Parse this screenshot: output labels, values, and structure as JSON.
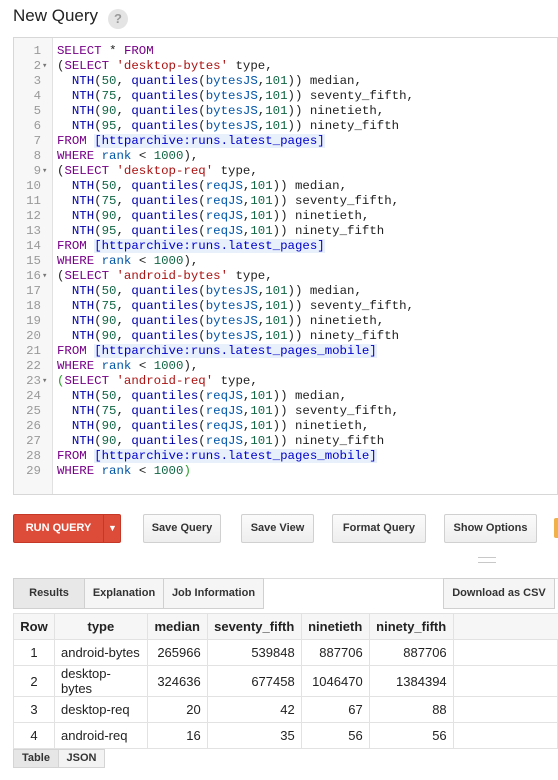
{
  "header": {
    "title": "New Query",
    "help_label": "?"
  },
  "editor": {
    "lines": [
      {
        "n": "1",
        "fold": "",
        "t": [
          [
            "kw",
            "SELECT"
          ],
          [
            "",
            "*"
          ],
          [
            "kw",
            "FROM"
          ]
        ]
      },
      {
        "n": "2",
        "fold": "▾",
        "t": [
          [
            "",
            "("
          ],
          [
            "kw",
            "SELECT"
          ],
          [
            "str",
            "'desktop-bytes'"
          ],
          [
            "",
            "type,"
          ]
        ]
      },
      {
        "n": "3",
        "fold": "",
        "t": [
          [
            "",
            "  "
          ],
          [
            "fn",
            "NTH"
          ],
          [
            "",
            "("
          ],
          [
            "num",
            "50"
          ],
          [
            "",
            ", "
          ],
          [
            "fn",
            "quantiles"
          ],
          [
            "",
            "("
          ],
          [
            "var",
            "bytesJS"
          ],
          [
            "",
            ","
          ],
          [
            "num",
            "101"
          ],
          [
            "",
            "))"
          ],
          [
            "",
            " median,"
          ]
        ]
      },
      {
        "n": "4",
        "fold": "",
        "t": [
          [
            "",
            "  "
          ],
          [
            "fn",
            "NTH"
          ],
          [
            "",
            "("
          ],
          [
            "num",
            "75"
          ],
          [
            "",
            ", "
          ],
          [
            "fn",
            "quantiles"
          ],
          [
            "",
            "("
          ],
          [
            "var",
            "bytesJS"
          ],
          [
            "",
            ","
          ],
          [
            "num",
            "101"
          ],
          [
            "",
            "))"
          ],
          [
            "",
            " seventy_fifth,"
          ]
        ]
      },
      {
        "n": "5",
        "fold": "",
        "t": [
          [
            "",
            "  "
          ],
          [
            "fn",
            "NTH"
          ],
          [
            "",
            "("
          ],
          [
            "num",
            "90"
          ],
          [
            "",
            ", "
          ],
          [
            "fn",
            "quantiles"
          ],
          [
            "",
            "("
          ],
          [
            "var",
            "bytesJS"
          ],
          [
            "",
            ","
          ],
          [
            "num",
            "101"
          ],
          [
            "",
            "))"
          ],
          [
            "",
            " ninetieth,"
          ]
        ]
      },
      {
        "n": "6",
        "fold": "",
        "t": [
          [
            "",
            "  "
          ],
          [
            "fn",
            "NTH"
          ],
          [
            "",
            "("
          ],
          [
            "num",
            "95"
          ],
          [
            "",
            ", "
          ],
          [
            "fn",
            "quantiles"
          ],
          [
            "",
            "("
          ],
          [
            "var",
            "bytesJS"
          ],
          [
            "",
            ","
          ],
          [
            "num",
            "101"
          ],
          [
            "",
            "))"
          ],
          [
            "",
            " ninety_fifth"
          ]
        ]
      },
      {
        "n": "7",
        "fold": "",
        "t": [
          [
            "kw",
            "FROM"
          ],
          [
            "tbl",
            "[httparchive:runs.latest_pages]"
          ]
        ]
      },
      {
        "n": "8",
        "fold": "",
        "t": [
          [
            "kw",
            "WHERE"
          ],
          [
            "var",
            "rank"
          ],
          [
            "",
            "<"
          ],
          [
            "num",
            "1000"
          ],
          [
            "",
            "),"
          ]
        ]
      },
      {
        "n": "9",
        "fold": "▾",
        "t": [
          [
            "",
            "("
          ],
          [
            "kw",
            "SELECT"
          ],
          [
            "str",
            "'desktop-req'"
          ],
          [
            "",
            "type,"
          ]
        ]
      },
      {
        "n": "10",
        "fold": "",
        "t": [
          [
            "",
            "  "
          ],
          [
            "fn",
            "NTH"
          ],
          [
            "",
            "("
          ],
          [
            "num",
            "50"
          ],
          [
            "",
            ", "
          ],
          [
            "fn",
            "quantiles"
          ],
          [
            "",
            "("
          ],
          [
            "var",
            "reqJS"
          ],
          [
            "",
            ","
          ],
          [
            "num",
            "101"
          ],
          [
            "",
            "))"
          ],
          [
            "",
            " median,"
          ]
        ]
      },
      {
        "n": "11",
        "fold": "",
        "t": [
          [
            "",
            "  "
          ],
          [
            "fn",
            "NTH"
          ],
          [
            "",
            "("
          ],
          [
            "num",
            "75"
          ],
          [
            "",
            ", "
          ],
          [
            "fn",
            "quantiles"
          ],
          [
            "",
            "("
          ],
          [
            "var",
            "reqJS"
          ],
          [
            "",
            ","
          ],
          [
            "num",
            "101"
          ],
          [
            "",
            "))"
          ],
          [
            "",
            " seventy_fifth,"
          ]
        ]
      },
      {
        "n": "12",
        "fold": "",
        "t": [
          [
            "",
            "  "
          ],
          [
            "fn",
            "NTH"
          ],
          [
            "",
            "("
          ],
          [
            "num",
            "90"
          ],
          [
            "",
            ", "
          ],
          [
            "fn",
            "quantiles"
          ],
          [
            "",
            "("
          ],
          [
            "var",
            "reqJS"
          ],
          [
            "",
            ","
          ],
          [
            "num",
            "101"
          ],
          [
            "",
            "))"
          ],
          [
            "",
            " ninetieth,"
          ]
        ]
      },
      {
        "n": "13",
        "fold": "",
        "t": [
          [
            "",
            "  "
          ],
          [
            "fn",
            "NTH"
          ],
          [
            "",
            "("
          ],
          [
            "num",
            "95"
          ],
          [
            "",
            ", "
          ],
          [
            "fn",
            "quantiles"
          ],
          [
            "",
            "("
          ],
          [
            "var",
            "reqJS"
          ],
          [
            "",
            ","
          ],
          [
            "num",
            "101"
          ],
          [
            "",
            "))"
          ],
          [
            "",
            " ninety_fifth"
          ]
        ]
      },
      {
        "n": "14",
        "fold": "",
        "t": [
          [
            "kw",
            "FROM"
          ],
          [
            "tbl",
            "[httparchive:runs.latest_pages]"
          ]
        ]
      },
      {
        "n": "15",
        "fold": "",
        "t": [
          [
            "kw",
            "WHERE"
          ],
          [
            "var",
            "rank"
          ],
          [
            "",
            "<"
          ],
          [
            "num",
            "1000"
          ],
          [
            "",
            "),"
          ]
        ]
      },
      {
        "n": "16",
        "fold": "▾",
        "t": [
          [
            "",
            "("
          ],
          [
            "kw",
            "SELECT"
          ],
          [
            "str",
            "'android-bytes'"
          ],
          [
            "",
            "type,"
          ]
        ]
      },
      {
        "n": "17",
        "fold": "",
        "t": [
          [
            "",
            "  "
          ],
          [
            "fn",
            "NTH"
          ],
          [
            "",
            "("
          ],
          [
            "num",
            "50"
          ],
          [
            "",
            ", "
          ],
          [
            "fn",
            "quantiles"
          ],
          [
            "",
            "("
          ],
          [
            "var",
            "bytesJS"
          ],
          [
            "",
            ","
          ],
          [
            "num",
            "101"
          ],
          [
            "",
            "))"
          ],
          [
            "",
            " median,"
          ]
        ]
      },
      {
        "n": "18",
        "fold": "",
        "t": [
          [
            "",
            "  "
          ],
          [
            "fn",
            "NTH"
          ],
          [
            "",
            "("
          ],
          [
            "num",
            "75"
          ],
          [
            "",
            ", "
          ],
          [
            "fn",
            "quantiles"
          ],
          [
            "",
            "("
          ],
          [
            "var",
            "bytesJS"
          ],
          [
            "",
            ","
          ],
          [
            "num",
            "101"
          ],
          [
            "",
            "))"
          ],
          [
            "",
            " seventy_fifth,"
          ]
        ]
      },
      {
        "n": "19",
        "fold": "",
        "t": [
          [
            "",
            "  "
          ],
          [
            "fn",
            "NTH"
          ],
          [
            "",
            "("
          ],
          [
            "num",
            "90"
          ],
          [
            "",
            ", "
          ],
          [
            "fn",
            "quantiles"
          ],
          [
            "",
            "("
          ],
          [
            "var",
            "bytesJS"
          ],
          [
            "",
            ","
          ],
          [
            "num",
            "101"
          ],
          [
            "",
            "))"
          ],
          [
            "",
            " ninetieth,"
          ]
        ]
      },
      {
        "n": "20",
        "fold": "",
        "t": [
          [
            "",
            "  "
          ],
          [
            "fn",
            "NTH"
          ],
          [
            "",
            "("
          ],
          [
            "num",
            "90"
          ],
          [
            "",
            ", "
          ],
          [
            "fn",
            "quantiles"
          ],
          [
            "",
            "("
          ],
          [
            "var",
            "bytesJS"
          ],
          [
            "",
            ","
          ],
          [
            "num",
            "101"
          ],
          [
            "",
            "))"
          ],
          [
            "",
            " ninety_fifth"
          ]
        ]
      },
      {
        "n": "21",
        "fold": "",
        "t": [
          [
            "kw",
            "FROM"
          ],
          [
            "tbl",
            "[httparchive:runs.latest_pages_mobile]"
          ]
        ]
      },
      {
        "n": "22",
        "fold": "",
        "t": [
          [
            "kw",
            "WHERE"
          ],
          [
            "var",
            "rank"
          ],
          [
            "",
            "<"
          ],
          [
            "num",
            "1000"
          ],
          [
            "",
            "),"
          ]
        ]
      },
      {
        "n": "23",
        "fold": "▾",
        "t": [
          [
            "br",
            "("
          ],
          [
            "kw",
            "SELECT"
          ],
          [
            "str",
            "'android-req'"
          ],
          [
            "",
            "type,"
          ]
        ]
      },
      {
        "n": "24",
        "fold": "",
        "t": [
          [
            "",
            "  "
          ],
          [
            "fn",
            "NTH"
          ],
          [
            "",
            "("
          ],
          [
            "num",
            "50"
          ],
          [
            "",
            ", "
          ],
          [
            "fn",
            "quantiles"
          ],
          [
            "",
            "("
          ],
          [
            "var",
            "reqJS"
          ],
          [
            "",
            ","
          ],
          [
            "num",
            "101"
          ],
          [
            "",
            "))"
          ],
          [
            "",
            " median,"
          ]
        ]
      },
      {
        "n": "25",
        "fold": "",
        "t": [
          [
            "",
            "  "
          ],
          [
            "fn",
            "NTH"
          ],
          [
            "",
            "("
          ],
          [
            "num",
            "75"
          ],
          [
            "",
            ", "
          ],
          [
            "fn",
            "quantiles"
          ],
          [
            "",
            "("
          ],
          [
            "var",
            "reqJS"
          ],
          [
            "",
            ","
          ],
          [
            "num",
            "101"
          ],
          [
            "",
            "))"
          ],
          [
            "",
            " seventy_fifth,"
          ]
        ]
      },
      {
        "n": "26",
        "fold": "",
        "t": [
          [
            "",
            "  "
          ],
          [
            "fn",
            "NTH"
          ],
          [
            "",
            "("
          ],
          [
            "num",
            "90"
          ],
          [
            "",
            ", "
          ],
          [
            "fn",
            "quantiles"
          ],
          [
            "",
            "("
          ],
          [
            "var",
            "reqJS"
          ],
          [
            "",
            ","
          ],
          [
            "num",
            "101"
          ],
          [
            "",
            "))"
          ],
          [
            "",
            " ninetieth,"
          ]
        ]
      },
      {
        "n": "27",
        "fold": "",
        "t": [
          [
            "",
            "  "
          ],
          [
            "fn",
            "NTH"
          ],
          [
            "",
            "("
          ],
          [
            "num",
            "90"
          ],
          [
            "",
            ", "
          ],
          [
            "fn",
            "quantiles"
          ],
          [
            "",
            "("
          ],
          [
            "var",
            "reqJS"
          ],
          [
            "",
            ","
          ],
          [
            "num",
            "101"
          ],
          [
            "",
            "))"
          ],
          [
            "",
            " ninety_fifth"
          ]
        ]
      },
      {
        "n": "28",
        "fold": "",
        "t": [
          [
            "kw",
            "FROM"
          ],
          [
            "tbl",
            "[httparchive:runs.latest_pages_mobile]"
          ]
        ]
      },
      {
        "n": "29",
        "fold": "",
        "t": [
          [
            "kw",
            "WHERE"
          ],
          [
            "var",
            "rank"
          ],
          [
            "",
            "<"
          ],
          [
            "num",
            "1000"
          ],
          [
            "br",
            ")"
          ]
        ]
      }
    ]
  },
  "toolbar": {
    "run_label": "RUN QUERY",
    "save_query": "Save Query",
    "save_view": "Save View",
    "format_query": "Format Query",
    "show_options": "Show Options"
  },
  "results_tabs": {
    "results": "Results",
    "explanation": "Explanation",
    "job_information": "Job Information",
    "download_csv": "Download as CSV"
  },
  "table": {
    "headers": [
      "Row",
      "type",
      "median",
      "seventy_fifth",
      "ninetieth",
      "ninety_fifth"
    ],
    "rows": [
      [
        "1",
        "android-bytes",
        "265966",
        "539848",
        "887706",
        "887706"
      ],
      [
        "2",
        "desktop-bytes",
        "324636",
        "677458",
        "1046470",
        "1384394"
      ],
      [
        "3",
        "desktop-req",
        "20",
        "42",
        "67",
        "88"
      ],
      [
        "4",
        "android-req",
        "16",
        "35",
        "56",
        "56"
      ]
    ]
  },
  "view_tabs": {
    "table": "Table",
    "json": "JSON"
  },
  "colors": {
    "accent_red": "#dd4b39",
    "keyword": "#770088",
    "string": "#aa1111",
    "function": "#0000aa",
    "number": "#116644",
    "table_ref": "#0000cc"
  }
}
